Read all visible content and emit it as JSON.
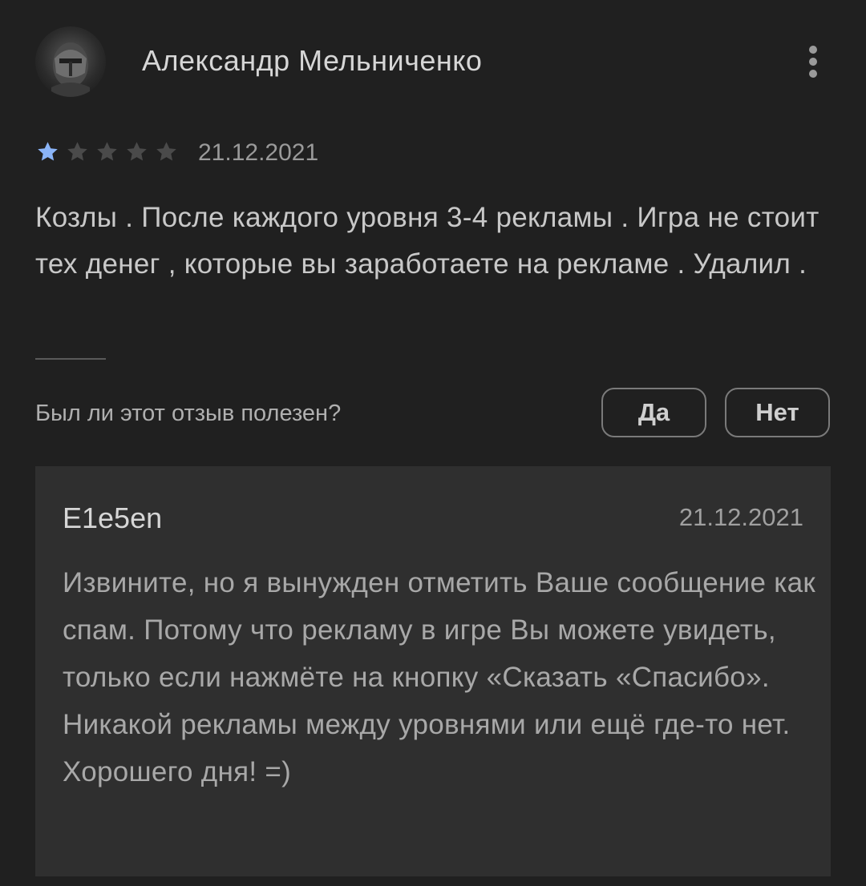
{
  "review": {
    "author": "Александр Мельниченко",
    "rating": 1,
    "rating_max": 5,
    "date": "21.12.2021",
    "text": "Козлы . После каждого уровня 3-4 рекламы . Игра не стоит тех денег , которые вы заработаете на рекламе . Удалил ."
  },
  "helpful": {
    "question": "Был ли этот отзыв полезен?",
    "yes_label": "Да",
    "no_label": "Нет"
  },
  "reply": {
    "author": "E1e5en",
    "date": "21.12.2021",
    "text": "Извините, но я вынужден отметить Ваше сообщение как спам. Потому что рекламу в игре Вы можете увидеть, только если нажмёте на кнопку «Сказать «Спасибо». Никакой рекламы между уровнями или ещё где-то нет. Хорошего дня! =)"
  },
  "colors": {
    "background": "#202020",
    "reply_background": "#2f2f2f",
    "star_filled": "#8ab4f8",
    "star_empty": "#4a4a4a"
  },
  "icons": {
    "avatar": "helmet-avatar-image",
    "menu": "more-vert-icon",
    "star": "star-icon"
  }
}
